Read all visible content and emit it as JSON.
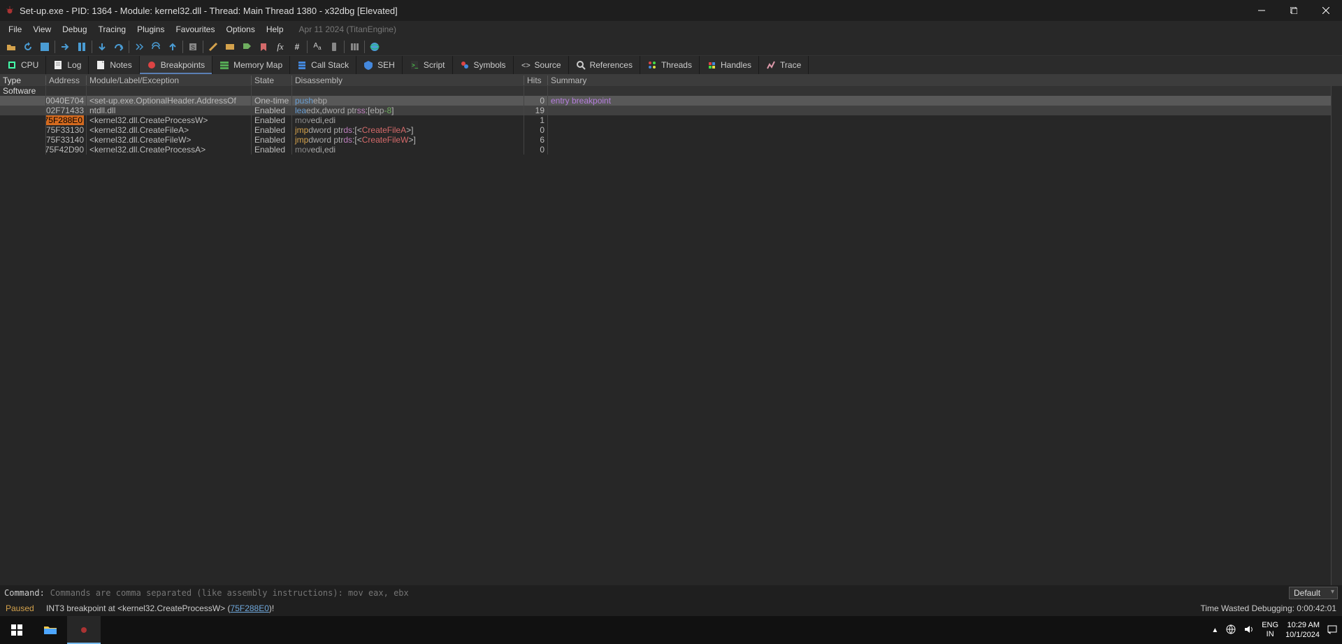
{
  "title": "Set-up.exe - PID: 1364 - Module: kernel32.dll - Thread: Main Thread 1380 - x32dbg [Elevated]",
  "menu": {
    "items": [
      "File",
      "View",
      "Debug",
      "Tracing",
      "Plugins",
      "Favourites",
      "Options",
      "Help"
    ],
    "build": "Apr 11 2024 (TitanEngine)"
  },
  "tabs": [
    {
      "label": "CPU"
    },
    {
      "label": "Log"
    },
    {
      "label": "Notes"
    },
    {
      "label": "Breakpoints",
      "active": true
    },
    {
      "label": "Memory Map"
    },
    {
      "label": "Call Stack"
    },
    {
      "label": "SEH"
    },
    {
      "label": "Script"
    },
    {
      "label": "Symbols"
    },
    {
      "label": "Source"
    },
    {
      "label": "References"
    },
    {
      "label": "Threads"
    },
    {
      "label": "Handles"
    },
    {
      "label": "Trace"
    }
  ],
  "columns": [
    "Type",
    "Address",
    "Module/Label/Exception",
    "State",
    "Disassembly",
    "Hits",
    "Summary"
  ],
  "type_group": "Software",
  "rows": [
    {
      "addr": "0040E704",
      "mod": "<set-up.exe.OptionalHeader.AddressOf",
      "state": "One-time",
      "dis_html": "<span class='op-push'>push</span> <span class='reg'>ebp</span>",
      "hits": "0",
      "summary": "entry breakpoint",
      "sel": "sel"
    },
    {
      "addr": "02F71433",
      "mod": "ntdll.dll",
      "state": "Enabled",
      "dis_html": "<span class='op-lea'>lea</span> <span class='reg'>edx</span>,<span class='reg'>dword ptr</span> <span class='segp'>ss</span>:[<span class='reg'>ebp</span><span class='num'>-8</span>]",
      "hits": "19",
      "summary": "",
      "sel": "sel2"
    },
    {
      "addr": "75F288E0",
      "addr_hl": true,
      "mod": "<kernel32.dll.CreateProcessW>",
      "state": "Enabled",
      "dis_html": "<span class='op-mov'>mov</span> <span class='reg'>edi</span>,<span class='reg'>edi</span>",
      "hits": "1",
      "summary": ""
    },
    {
      "addr": "75F33130",
      "mod": "<kernel32.dll.CreateFileA>",
      "state": "Enabled",
      "dis_html": "<span class='op-jmp'>jmp</span> <span class='reg'>dword ptr</span> <span class='segp'>ds</span>:[&lt;<span class='call-w'>CreateFileA</span>&gt;]",
      "hits": "0",
      "summary": ""
    },
    {
      "addr": "75F33140",
      "mod": "<kernel32.dll.CreateFileW>",
      "state": "Enabled",
      "dis_html": "<span class='op-jmp'>jmp</span> <span class='reg'>dword ptr</span> <span class='segp'>ds</span>:[&lt;<span class='call-w'>CreateFileW</span>&gt;]",
      "hits": "6",
      "summary": ""
    },
    {
      "addr": "75F42D90",
      "mod": "<kernel32.dll.CreateProcessA>",
      "state": "Enabled",
      "dis_html": "<span class='op-mov'>mov</span> <span class='reg'>edi</span>,<span class='reg'>edi</span>",
      "hits": "0",
      "summary": ""
    }
  ],
  "command": {
    "label": "Command:",
    "placeholder": "Commands are comma separated (like assembly instructions): mov eax, ebx",
    "combo": "Default"
  },
  "status": {
    "paused": "Paused",
    "msg_pre": "INT3 breakpoint at <kernel32.CreateProcessW> (",
    "link": "75F288E0",
    "msg_post": ")!",
    "time": "Time Wasted Debugging: 0:00:42:01"
  },
  "tray": {
    "lang1": "ENG",
    "lang2": "IN",
    "time": "10:29 AM",
    "date": "10/1/2024"
  }
}
